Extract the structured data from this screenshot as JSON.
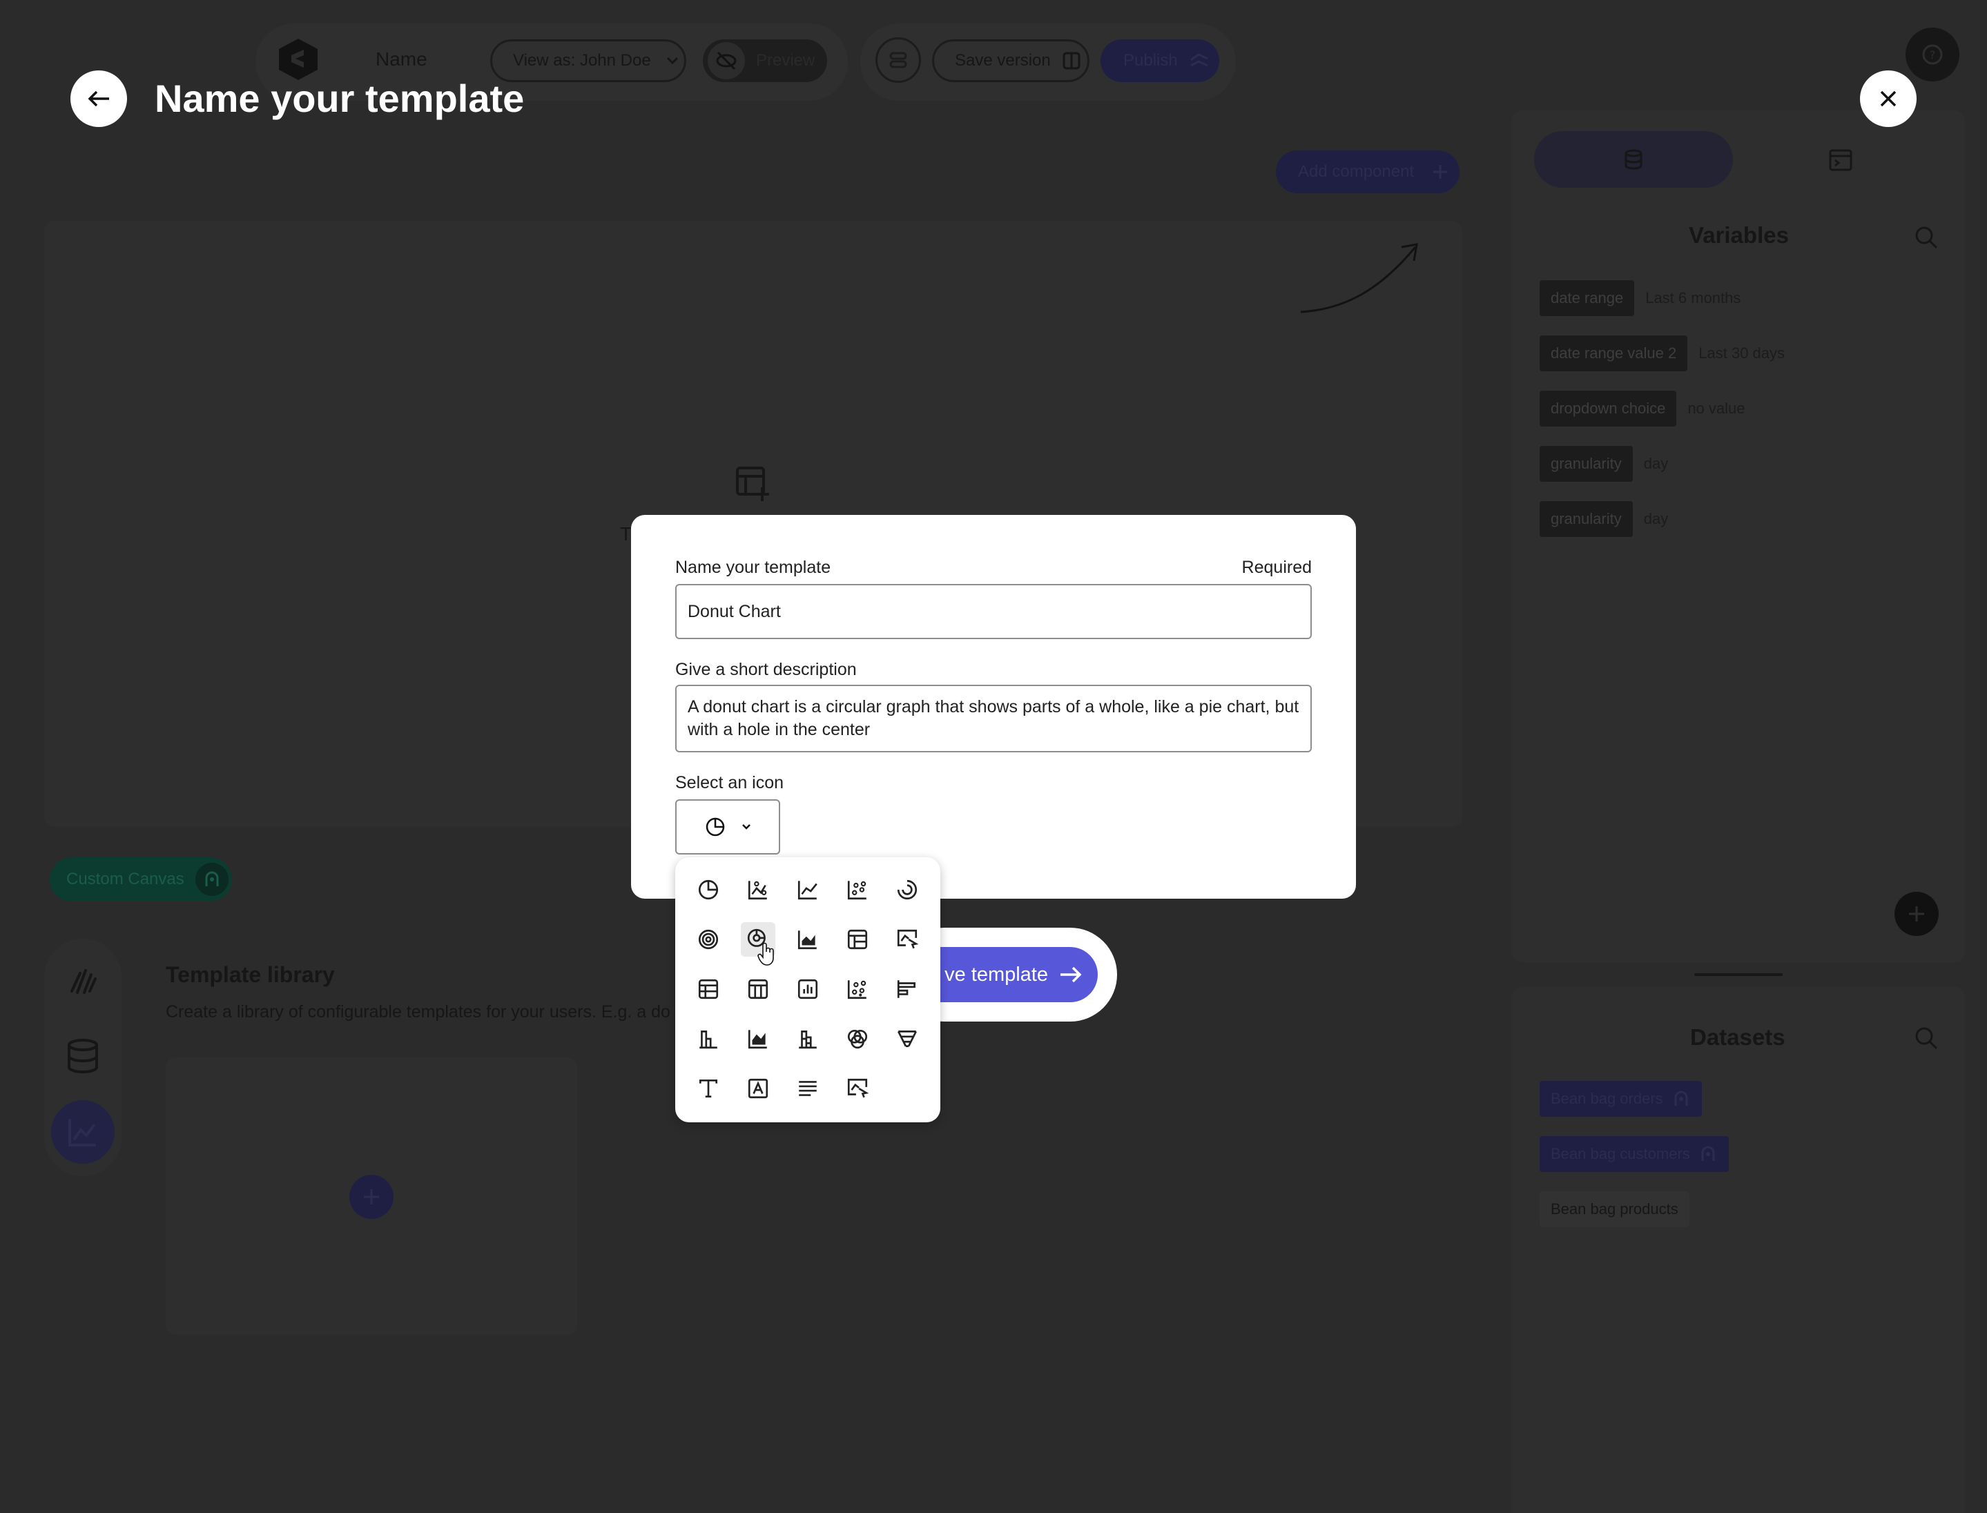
{
  "topbar": {
    "logo_icon": "e-logo",
    "name_label": "Name",
    "view_as_label": "View as: John Doe",
    "preview_label": "Preview",
    "save_version_label": "Save version",
    "publish_label": "Publish"
  },
  "canvas": {
    "add_component_label": "Add component",
    "placeholder_char": "T"
  },
  "custom_canvas_label": "Custom Canvas",
  "template_library": {
    "title": "Template library",
    "description": "Create a library of configurable templates for your users. E.g. a do"
  },
  "variables_panel": {
    "title": "Variables",
    "items": [
      {
        "name": "date range",
        "value": "Last 6 months"
      },
      {
        "name": "date range value 2",
        "value": "Last 30 days"
      },
      {
        "name": "dropdown choice",
        "value": "no value"
      },
      {
        "name": "granularity",
        "value": "day"
      },
      {
        "name": "granularity",
        "value": "day"
      }
    ]
  },
  "datasets_panel": {
    "title": "Datasets",
    "items": [
      "Bean bag orders",
      "Bean bag customers",
      "Bean bag products"
    ]
  },
  "page_title": "Name your template",
  "modal": {
    "name_label": "Name your template",
    "required_label": "Required",
    "name_value": "Donut Chart",
    "description_label": "Give a short description",
    "description_value": "A donut chart is a circular graph that shows parts of a whole, like a pie chart, but with a hole in the center",
    "icon_label": "Select an icon",
    "selected_icon": "pie-chart-icon",
    "save_button_label": "ve template"
  },
  "icon_picker": [
    "pie-chart-icon",
    "area-line-points-icon",
    "line-chart-icon",
    "scatter-icon",
    "radial-icon",
    "target-icon",
    "donut-chart-icon",
    "area-chart-icon",
    "table-icon",
    "pointer-chart-icon",
    "table-alt-icon",
    "pivot-table-icon",
    "bar-box-icon",
    "scatter-box-icon",
    "horizontal-bar-icon",
    "column-chart-icon",
    "filled-area-icon",
    "stacked-column-icon",
    "venn-icon",
    "funnel-icon",
    "text-icon",
    "text-box-icon",
    "paragraph-icon",
    "pointer-chart-alt-icon"
  ],
  "colors": {
    "accent": "#5757d9",
    "overlay_bg": "#2b2b2b",
    "custom_canvas_green": "#0c5b47"
  }
}
